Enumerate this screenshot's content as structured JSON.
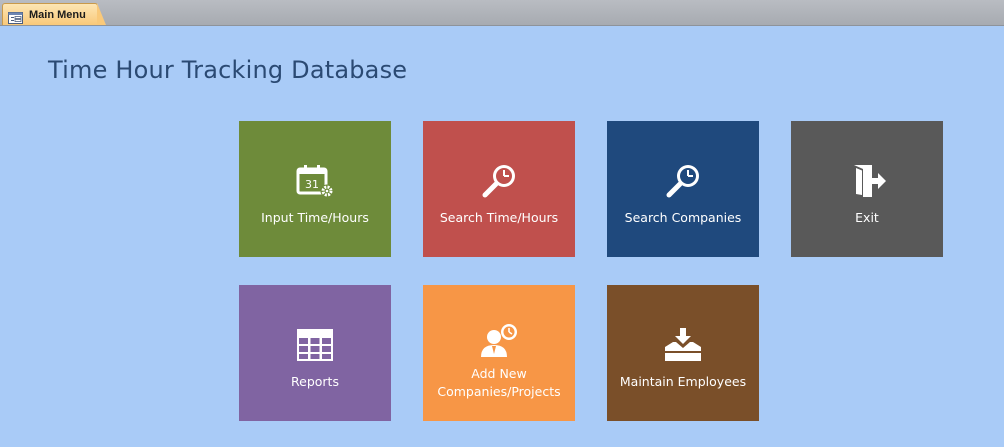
{
  "tab": {
    "label": "Main Menu",
    "icon": "form-icon"
  },
  "page": {
    "title": "Time Hour Tracking Database"
  },
  "colors": {
    "background": "#a9cbf7",
    "input": "#6e8b3a",
    "search_time": "#c0504d",
    "search_companies": "#1f497d",
    "exit": "#595959",
    "reports": "#8064a2",
    "add_new": "#f79646",
    "maintain": "#7a4f29"
  },
  "tiles": {
    "input_time": {
      "label": "Input Time/Hours",
      "icon": "calendar-settings-icon"
    },
    "search_time": {
      "label": "Search Time/Hours",
      "icon": "search-clock-icon"
    },
    "search_companies": {
      "label": "Search Companies",
      "icon": "search-clock-icon"
    },
    "exit": {
      "label": "Exit",
      "icon": "exit-door-icon"
    },
    "reports": {
      "label": "Reports",
      "icon": "table-grid-icon"
    },
    "add_new": {
      "label": "Add New\nCompanies/Projects",
      "icon": "person-clock-icon"
    },
    "maintain": {
      "label": "Maintain Employees",
      "icon": "inbox-download-icon"
    }
  }
}
